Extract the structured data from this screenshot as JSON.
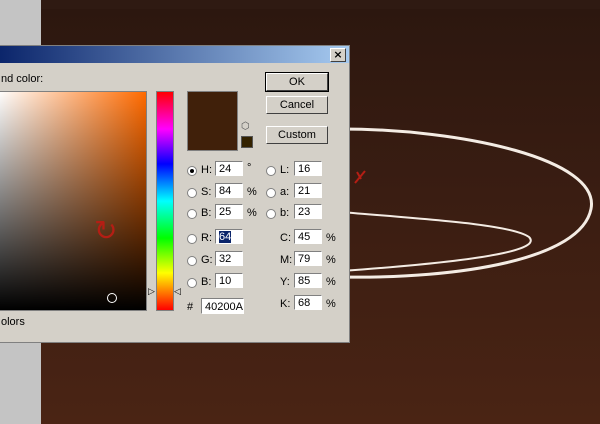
{
  "dialog": {
    "title_fragment": "nd color:",
    "bottom_fragment": "olors",
    "close_glyph": "×",
    "ok_label": "OK",
    "cancel_label": "Cancel",
    "custom_label": "Custom",
    "new_color_hex": "#40200A",
    "hex_prefix": "#",
    "hex_value": "40200A"
  },
  "hsb": [
    {
      "label": "H:",
      "value": "24",
      "unit": "°",
      "selected": true
    },
    {
      "label": "S:",
      "value": "84",
      "unit": "%",
      "selected": false
    },
    {
      "label": "B:",
      "value": "25",
      "unit": "%",
      "selected": false
    }
  ],
  "rgb": [
    {
      "label": "R:",
      "value": "64",
      "selected": false
    },
    {
      "label": "G:",
      "value": "32",
      "selected": false
    },
    {
      "label": "B:",
      "value": "10",
      "selected": false
    }
  ],
  "lab": [
    {
      "label": "L:",
      "value": "16"
    },
    {
      "label": "a:",
      "value": "21"
    },
    {
      "label": "b:",
      "value": "23"
    }
  ],
  "cmyk": [
    {
      "label": "C:",
      "value": "45",
      "unit": "%"
    },
    {
      "label": "M:",
      "value": "79",
      "unit": "%"
    },
    {
      "label": "Y:",
      "value": "85",
      "unit": "%"
    },
    {
      "label": "K:",
      "value": "68",
      "unit": "%"
    }
  ],
  "colors": {
    "titlebar_start": "#0a246a",
    "dialog_bg": "#d4d0c8",
    "canvas_bg": "#3a1d12",
    "stroke_white": "#f4ece4",
    "stroke_red": "#b41e14"
  }
}
